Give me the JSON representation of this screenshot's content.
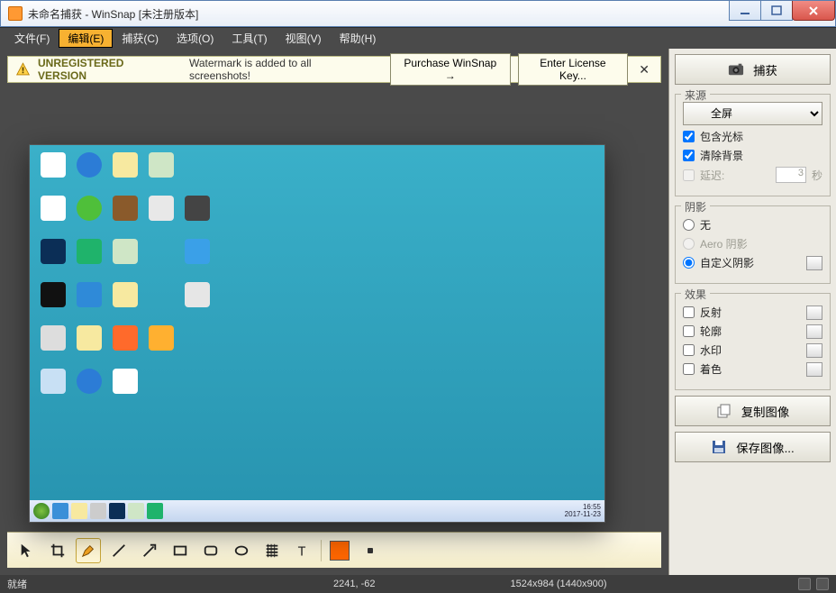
{
  "window": {
    "title": "未命名捕获 - WinSnap  [未注册版本]"
  },
  "menu": {
    "file": "文件(F)",
    "edit": "编辑(E)",
    "capture": "捕获(C)",
    "options": "选项(O)",
    "tools": "工具(T)",
    "view": "视图(V)",
    "help": "帮助(H)"
  },
  "notice": {
    "bold": "UNREGISTERED VERSION",
    "text": "Watermark is added to all screenshots!",
    "purchase": "Purchase WinSnap →",
    "license": "Enter License Key..."
  },
  "side": {
    "capture": "捕获",
    "source_title": "来源",
    "source_value": "全屏",
    "include_cursor": "包含光标",
    "clear_bg": "清除背景",
    "delay_label": "延迟:",
    "delay_value": "3",
    "delay_unit": "秒",
    "shadow_title": "阴影",
    "shadow_none": "无",
    "shadow_aero": "Aero 阴影",
    "shadow_custom": "自定义阴影",
    "effect_title": "效果",
    "reflect": "反射",
    "outline": "轮廓",
    "watermark": "水印",
    "tint": "着色",
    "copy": "复制图像",
    "save": "保存图像..."
  },
  "status": {
    "ready": "就绪",
    "coords": "2241, -62",
    "dims": "1524x984 (1440x900)"
  },
  "taskbar": {
    "time": "16:55",
    "date": "2017-11-23"
  }
}
